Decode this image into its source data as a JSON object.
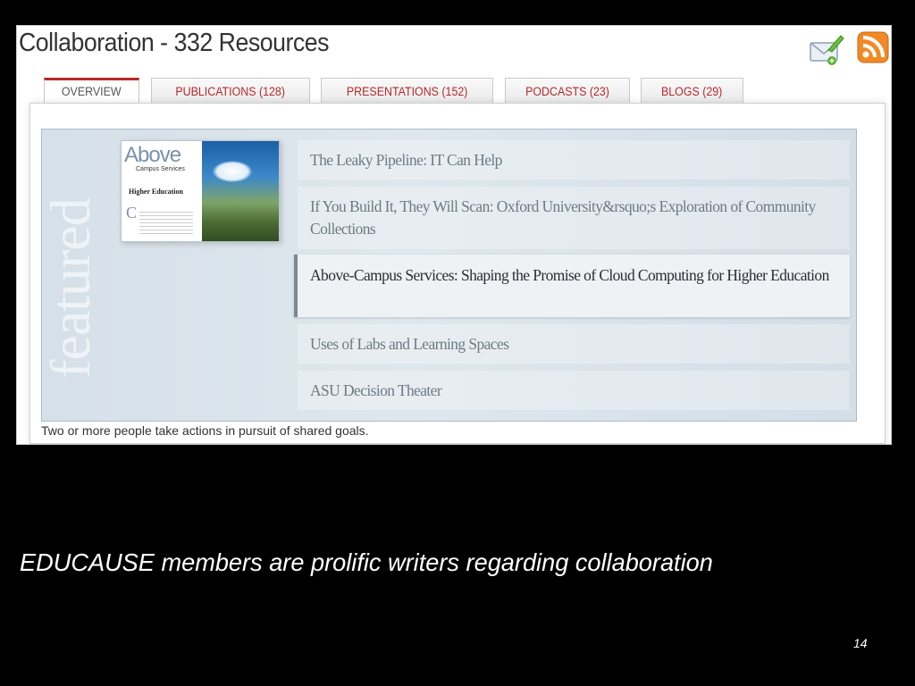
{
  "page_title": "Collaboration - 332 Resources",
  "icons": {
    "email": "email-icon",
    "rss": "rss-icon"
  },
  "colors": {
    "accent": "#b5282a",
    "rss_orange": "#f08a24",
    "featured_bg": "#d9e3ea"
  },
  "tabs": [
    {
      "label": "OVERVIEW",
      "active": true
    },
    {
      "label": "PUBLICATIONS (128)",
      "active": false
    },
    {
      "label": "PRESENTATIONS (152)",
      "active": false
    },
    {
      "label": "PODCASTS (23)",
      "active": false
    },
    {
      "label": "BLOGS (29)",
      "active": false
    }
  ],
  "featured": {
    "label": "featured",
    "thumbnail": {
      "heading": "Above",
      "subtitle": "Campus Services",
      "title_line": "Higher Education",
      "initial": "C"
    },
    "items": [
      {
        "title": "The Leaky Pipeline: IT Can Help",
        "selected": false
      },
      {
        "title": "If You Build It, They Will Scan: Oxford University&rsquo;s Exploration of Community Collections",
        "selected": false
      },
      {
        "title": "Above-Campus Services: Shaping the Promise of Cloud Computing for Higher Education",
        "selected": true
      },
      {
        "title": "Uses of Labs and Learning Spaces",
        "selected": false
      },
      {
        "title": "ASU Decision Theater",
        "selected": false
      }
    ]
  },
  "description": "Two or more people take actions in pursuit of shared goals.",
  "slide": {
    "caption": "EDUCAUSE members are prolific writers regarding collaboration",
    "page_number": "14"
  }
}
